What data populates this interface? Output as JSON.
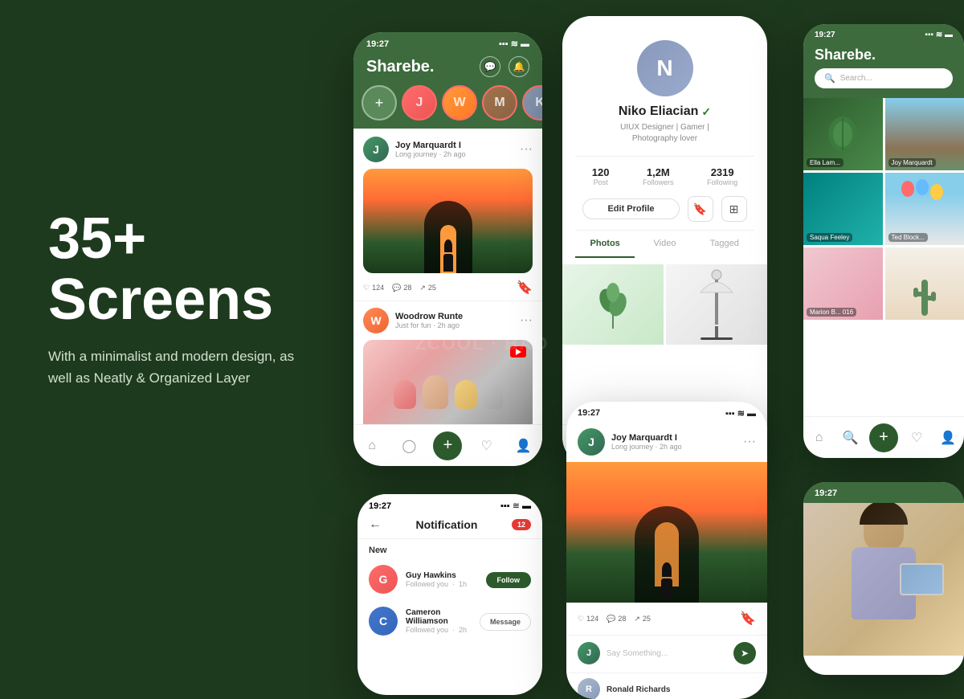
{
  "background": "#1e3a1e",
  "watermark": "ZCOOL · BAO",
  "left": {
    "headline": "35+\nScreens",
    "subtext": "With a minimalist and modern design, as well as Neatly & Organized Layer"
  },
  "phone_feed": {
    "status_time": "19:27",
    "app_title": "Sharebe.",
    "post1": {
      "username": "Joy Marquardt I",
      "caption": "Long journey",
      "time": "2h ago",
      "likes": "124",
      "comments": "28",
      "shares": "25"
    },
    "post2": {
      "username": "Woodrow Runte",
      "caption": "Just for fun",
      "time": "2h ago"
    }
  },
  "phone_profile": {
    "name": "Niko Eliacian",
    "bio_line1": "UIUX Designer | Gamer |",
    "bio_line2": "Photography lover",
    "stats": {
      "posts": "120",
      "posts_label": "Post",
      "followers": "1,2M",
      "followers_label": "Followers",
      "following": "2319",
      "following_label": "Following"
    },
    "edit_profile": "Edit Profile",
    "tabs": [
      "Photos",
      "Video",
      "Tagged"
    ]
  },
  "phone_explore": {
    "status_time": "19:27",
    "app_title": "Sharebe.",
    "search_placeholder": "Search...",
    "users": [
      "Ella Lam...",
      "Joy Marquardt",
      "Saqua Feeley",
      "Ted Block...",
      "Marion B... 016"
    ]
  },
  "phone_notification": {
    "status_time": "19:27",
    "title": "Notification",
    "badge": "12",
    "section": "New",
    "items": [
      {
        "name": "Guy Hawkins",
        "action": "Followed you",
        "time": "1h",
        "btn": "Follow"
      },
      {
        "name": "Cameron Williamson",
        "action": "Followed you",
        "time": "2h",
        "btn": "Message"
      }
    ]
  },
  "phone_post_detail": {
    "status_time": "19:27",
    "username": "Joy Marquardt I",
    "caption": "Long journey",
    "time": "2h ago",
    "likes": "124",
    "comments": "28",
    "shares": "25",
    "comment_placeholder": "Say Something...",
    "name_below": "Ronald Richards"
  },
  "phone_story": {
    "status_time": "19:27"
  }
}
